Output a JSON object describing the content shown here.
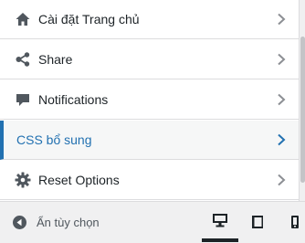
{
  "menu": {
    "items": [
      {
        "label": "Cài đặt Trang chủ",
        "icon": "home-icon"
      },
      {
        "label": "Share",
        "icon": "share-icon"
      },
      {
        "label": "Notifications",
        "icon": "comment-icon"
      },
      {
        "label": "CSS bổ sung",
        "icon": "",
        "active": true
      },
      {
        "label": "Reset Options",
        "icon": "gear-icon"
      }
    ]
  },
  "footer": {
    "collapse_label": "Ẩn tùy chọn",
    "devices": [
      "desktop",
      "tablet",
      "mobile"
    ],
    "active_device": "desktop"
  },
  "colors": {
    "accent": "#2271b1",
    "text": "#1d2327",
    "icon": "#50575e",
    "chevron": "#8c8f94"
  }
}
